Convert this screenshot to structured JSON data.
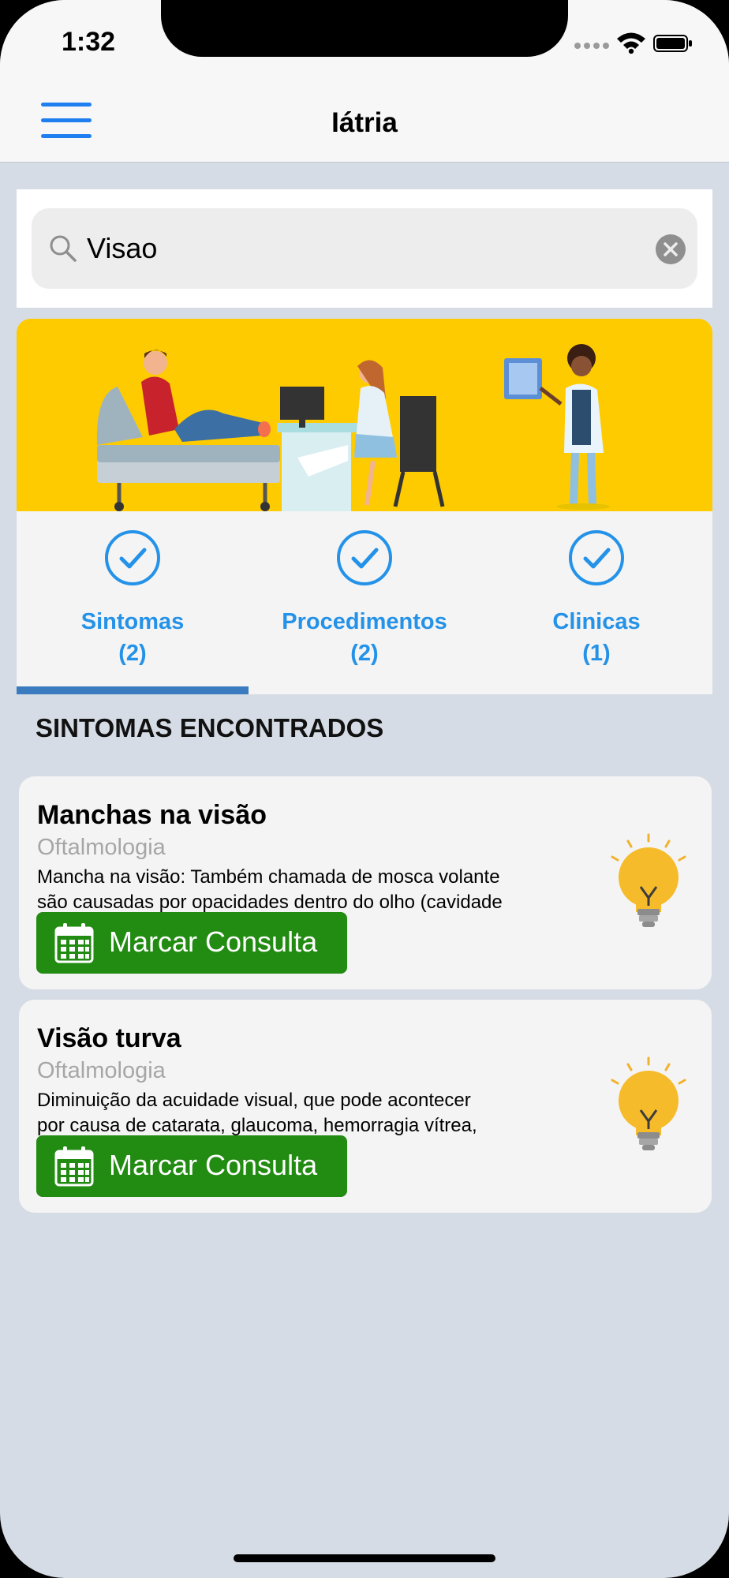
{
  "status_bar": {
    "time": "1:32"
  },
  "header": {
    "title": "Iátria"
  },
  "search": {
    "value": "Visao",
    "placeholder": ""
  },
  "tabs": [
    {
      "label": "Sintomas",
      "count": "(2)",
      "selected": true
    },
    {
      "label": "Procedimentos",
      "count": "(2)",
      "selected": false
    },
    {
      "label": "Clinicas",
      "count": "(1)",
      "selected": false
    }
  ],
  "section": {
    "title": "SINTOMAS ENCONTRADOS"
  },
  "results": [
    {
      "title": "Manchas na visão",
      "specialty": "Oftalmologia",
      "description_line1": "Mancha na visão: Também chamada de mosca volante",
      "description_line2": "são causadas por opacidades dentro do olho (cavidade",
      "button_label": "Marcar Consulta"
    },
    {
      "title": "Visão turva",
      "specialty": "Oftalmologia",
      "description_line1": "Diminuição da acuidade visual, que pode acontecer",
      "description_line2": "por causa de catarata, glaucoma, hemorragia vítrea,",
      "button_label": "Marcar Consulta"
    }
  ],
  "colors": {
    "accent_blue": "#2492e8",
    "banner_yellow": "#fecb00",
    "button_green": "#228b12",
    "background": "#d6dce5"
  },
  "icons": [
    "menu-icon",
    "search-icon",
    "clear-icon",
    "check-circle-icon",
    "lightbulb-icon",
    "calendar-icon"
  ]
}
